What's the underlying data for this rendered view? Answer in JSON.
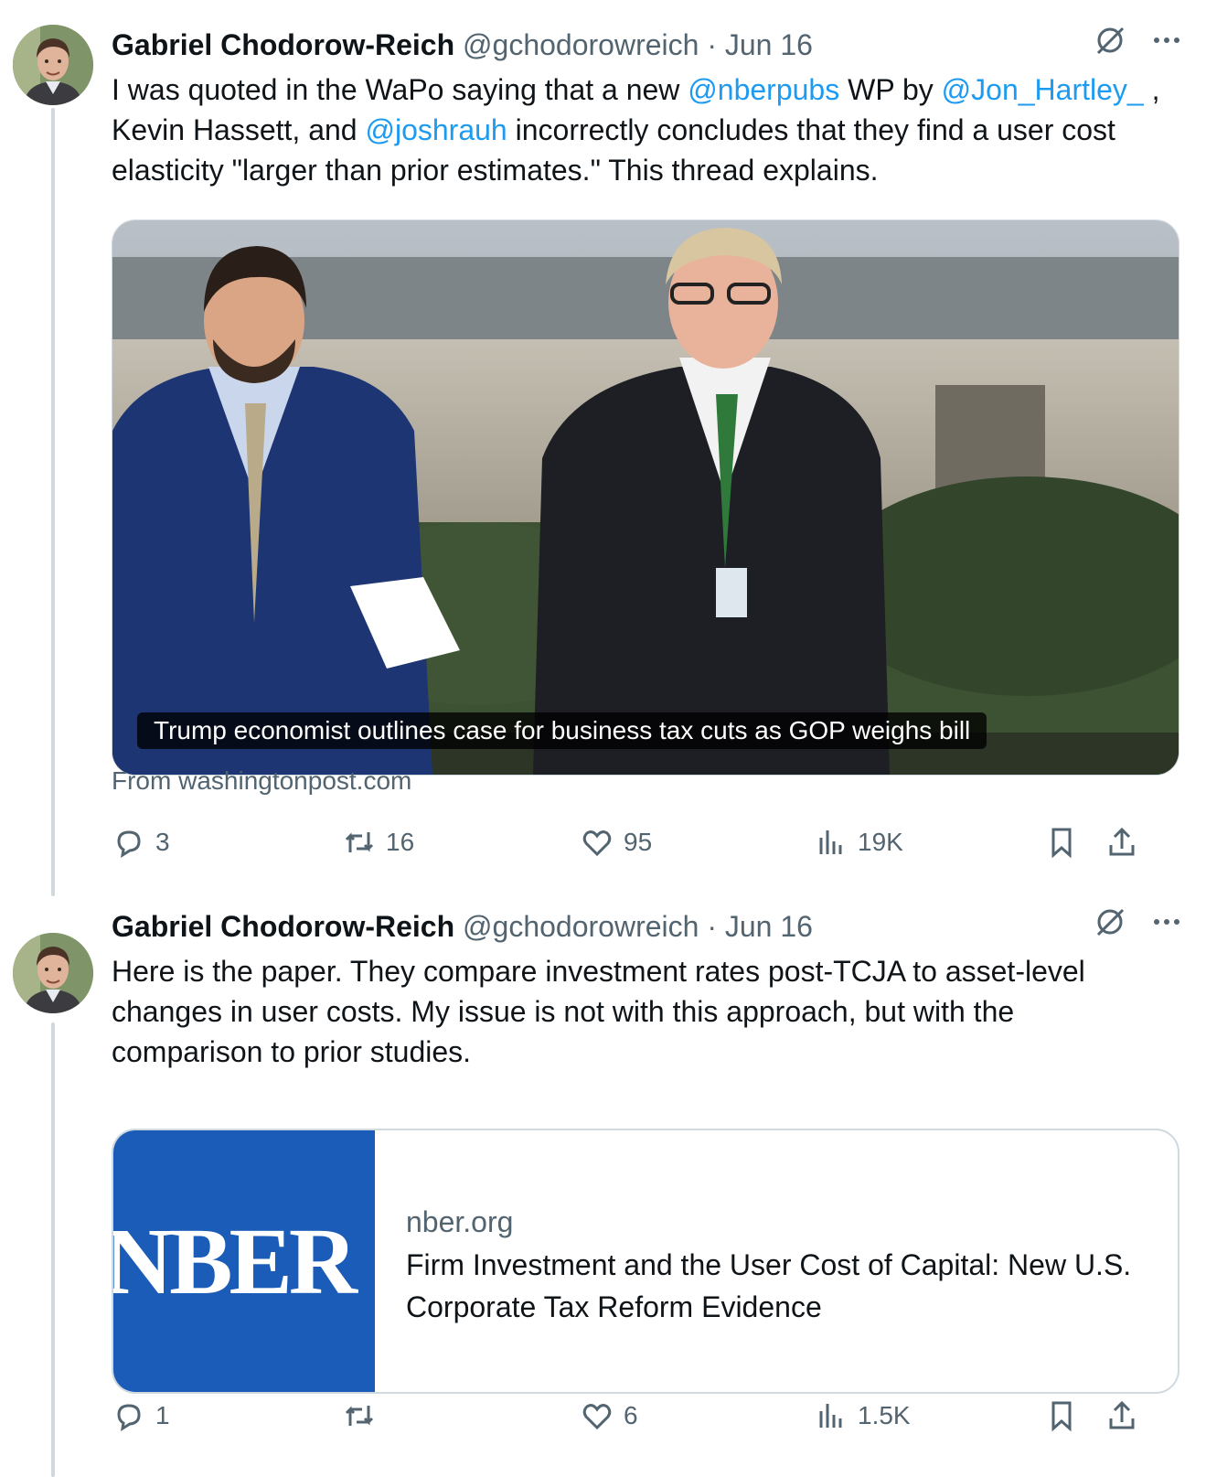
{
  "thread": [
    {
      "author": {
        "name": "Gabriel Chodorow-Reich",
        "handle": "@gchodorowreich",
        "separator": "·",
        "date": "Jun 16"
      },
      "text_parts": [
        {
          "text": "I was quoted in the WaPo saying that a new ",
          "link": false
        },
        {
          "text": "@nberpubs",
          "link": true
        },
        {
          "text": " WP by ",
          "link": false
        },
        {
          "text": "@Jon_Hartley_",
          "link": true
        },
        {
          "text": " , Kevin Hassett, and ",
          "link": false
        },
        {
          "text": "@joshrauh",
          "link": true
        },
        {
          "text": " incorrectly concludes that they find a user cost elasticity \"larger than prior estimates.\" This thread explains.",
          "link": false
        }
      ],
      "media": {
        "caption": "Trump economist outlines case for business tax cuts as GOP weighs bill",
        "source": "From washingtonpost.com"
      },
      "actions": {
        "replies": "3",
        "reposts": "16",
        "likes": "95",
        "views": "19K"
      }
    },
    {
      "author": {
        "name": "Gabriel Chodorow-Reich",
        "handle": "@gchodorowreich",
        "separator": "·",
        "date": "Jun 16"
      },
      "text_parts": [
        {
          "text": "Here is the paper. They compare investment rates post-TCJA to asset-level changes in user costs. My issue is not with this approach, but with the comparison to prior studies.",
          "link": false
        }
      ],
      "card": {
        "logo_text": "NBER",
        "domain": "nber.org",
        "title": "Firm Investment and the User Cost of Capital: New U.S. Corporate Tax Reform Evidence"
      },
      "actions": {
        "replies": "1",
        "reposts": "",
        "likes": "6",
        "views": "1.5K"
      }
    }
  ],
  "colors": {
    "link": "#1d9bf0",
    "muted": "#536471",
    "thread_line": "#cfd9de",
    "nber_blue": "#1a5cb8"
  },
  "icons": [
    "grok-slash-icon",
    "more-icon",
    "reply-icon",
    "repost-icon",
    "like-icon",
    "views-icon",
    "bookmark-icon",
    "share-icon"
  ]
}
